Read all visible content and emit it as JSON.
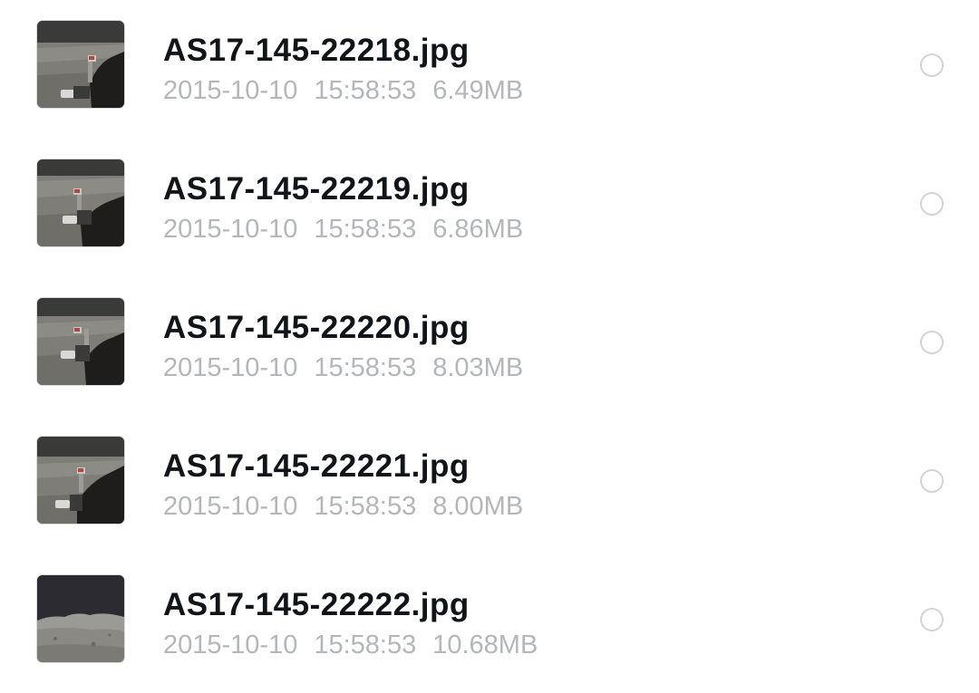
{
  "files": [
    {
      "name": "AS17-145-22218.jpg",
      "date": "2015-10-10",
      "time": "15:58:53",
      "size": "6.49MB",
      "thumbnail": "lunar-surface-flag-photo",
      "selected": false
    },
    {
      "name": "AS17-145-22219.jpg",
      "date": "2015-10-10",
      "time": "15:58:53",
      "size": "6.86MB",
      "thumbnail": "lunar-surface-flag-photo",
      "selected": false
    },
    {
      "name": "AS17-145-22220.jpg",
      "date": "2015-10-10",
      "time": "15:58:53",
      "size": "8.03MB",
      "thumbnail": "lunar-surface-flag-photo",
      "selected": false
    },
    {
      "name": "AS17-145-22221.jpg",
      "date": "2015-10-10",
      "time": "15:58:53",
      "size": "8.00MB",
      "thumbnail": "lunar-surface-flag-photo",
      "selected": false
    },
    {
      "name": "AS17-145-22222.jpg",
      "date": "2015-10-10",
      "time": "15:58:53",
      "size": "10.68MB",
      "thumbnail": "lunar-horizon-photo",
      "selected": false
    }
  ],
  "colors": {
    "title_text": "#111418",
    "meta_text": "#b4b6ba",
    "radio_border": "#d2d4d8",
    "background": "#ffffff"
  }
}
